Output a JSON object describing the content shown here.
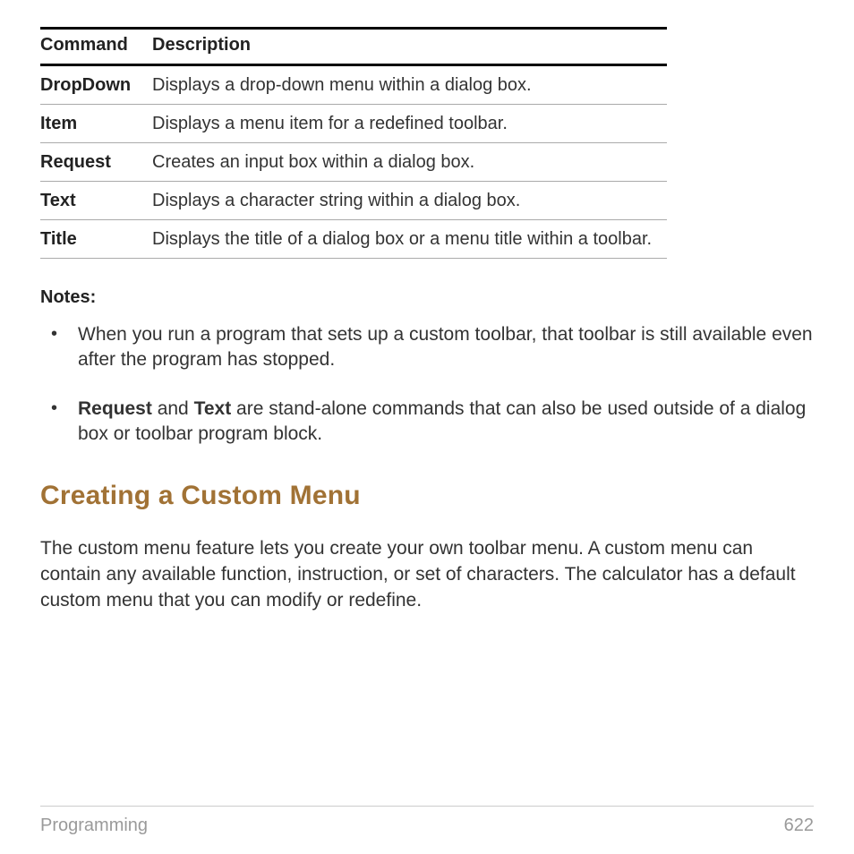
{
  "table": {
    "headers": {
      "command": "Command",
      "description": "Description"
    },
    "rows": [
      {
        "command": "DropDown",
        "description": "Displays a drop-down menu within a dialog box."
      },
      {
        "command": "Item",
        "description": "Displays a menu item for a redefined toolbar."
      },
      {
        "command": "Request",
        "description": "Creates an input box within a dialog box."
      },
      {
        "command": "Text",
        "description": "Displays a character string within a dialog box."
      },
      {
        "command": "Title",
        "description": "Displays the title of a dialog box or a menu title within a toolbar."
      }
    ]
  },
  "notes": {
    "label": "Notes:",
    "items": [
      {
        "pre": "",
        "bold1": "",
        "mid": "When you run a program that sets up a custom toolbar, that toolbar is still available even after the program has stopped.",
        "bold2": "",
        "post": ""
      },
      {
        "pre": "",
        "bold1": "Request",
        "mid": " and ",
        "bold2": "Text",
        "post": " are stand-alone commands that can also be used outside of a dialog box or toolbar program block."
      }
    ]
  },
  "section": {
    "heading": "Creating a Custom Menu",
    "paragraph": "The custom menu feature lets you create your own toolbar menu. A custom menu can contain any available function, instruction, or set of characters. The calculator has a default custom menu that you can modify or redefine."
  },
  "footer": {
    "left": "Programming",
    "right": "622"
  }
}
